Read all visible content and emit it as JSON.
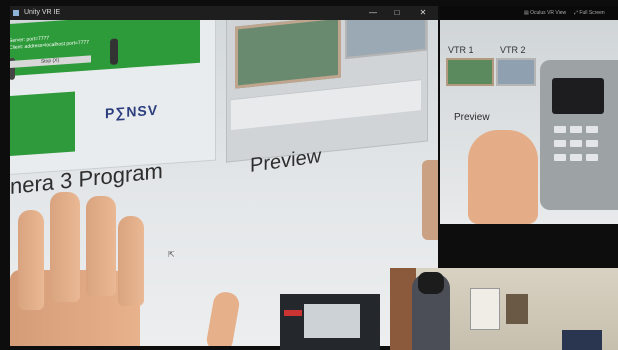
{
  "main_window": {
    "title": "Unity VR IE",
    "controls": [
      "—",
      "□",
      "✕"
    ]
  },
  "scene": {
    "server_line1": "Server: port=7777",
    "server_line2": "Client: address=localhost port=7777",
    "stop_button": "Stop (X)",
    "logo": "P∑NSV",
    "program_label": "nera 3  Program",
    "preview_label": "Preview"
  },
  "vr_view": {
    "bar_left": "▤ Oculus VR View",
    "bar_right": "⤢ Full Screen",
    "vtr1": "VTR 1",
    "vtr2": "VTR 2",
    "preview": "Preview"
  },
  "colors": {
    "green_screen": "#2e9b3a",
    "skin": "#e6b08b"
  }
}
